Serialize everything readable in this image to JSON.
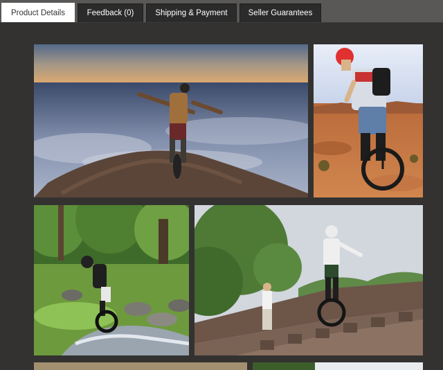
{
  "tabs": [
    {
      "label": "Product Details",
      "active": true
    },
    {
      "label": "Feedback (0)",
      "active": false
    },
    {
      "label": "Shipping & Payment",
      "active": false
    },
    {
      "label": "Seller Guarantees",
      "active": false
    }
  ],
  "gallery": {
    "photos": [
      {
        "name": "photo-unicyclist-mountain-summit"
      },
      {
        "name": "photo-unicyclist-red-helmet-desert"
      },
      {
        "name": "photo-unicyclist-forest-stream"
      },
      {
        "name": "photo-unicyclist-great-wall"
      }
    ]
  }
}
